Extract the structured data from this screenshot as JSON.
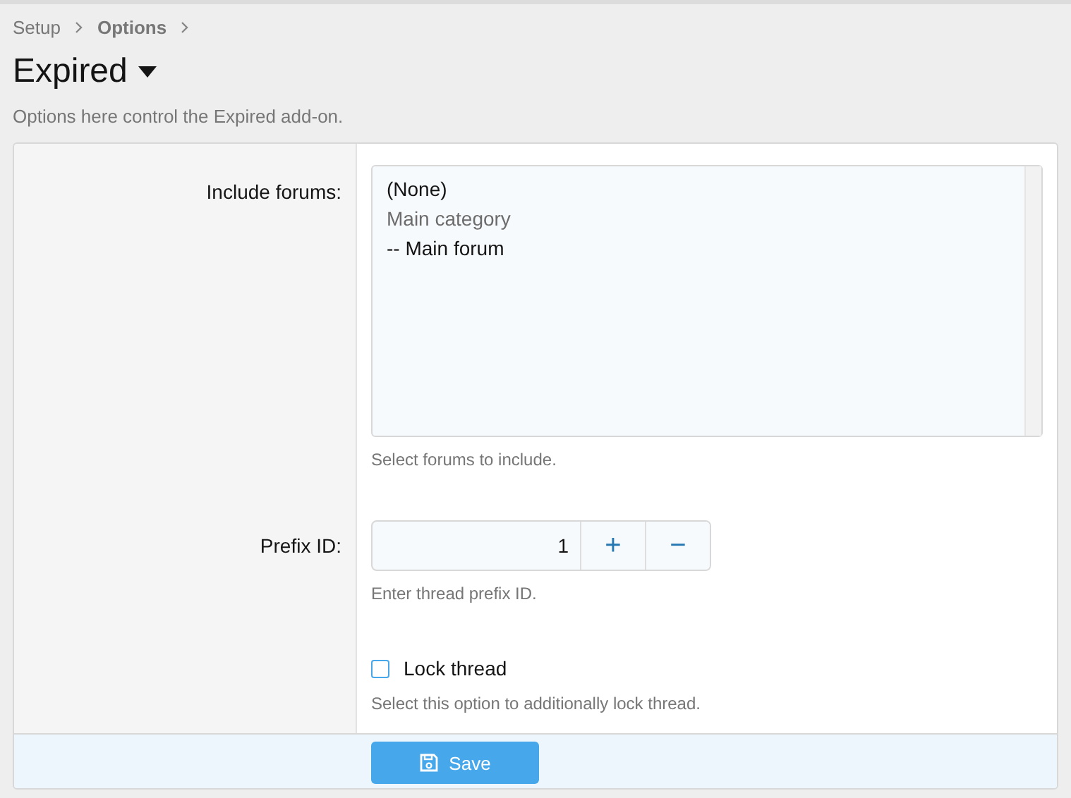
{
  "breadcrumb": [
    {
      "label": "Setup",
      "current": false
    },
    {
      "label": "Options",
      "current": true
    }
  ],
  "title": "Expired",
  "description": "Options here control the Expired add-on.",
  "form": {
    "rows": [
      {
        "kind": "listbox",
        "label": "Include forums:",
        "options": [
          {
            "label": "(None)",
            "disabled": false
          },
          {
            "label": "Main category",
            "disabled": true
          },
          {
            "label": "-- Main forum",
            "disabled": false
          }
        ],
        "hint": "Select forums to include."
      },
      {
        "kind": "number",
        "label": "Prefix ID:",
        "value": "1",
        "increment": "+",
        "decrement": "−",
        "hint": "Enter thread prefix ID."
      },
      {
        "kind": "checkbox",
        "option": "Lock thread",
        "checked": false,
        "hint": "Select this option to additionally lock thread."
      }
    ]
  },
  "submit": {
    "label": "Save"
  }
}
